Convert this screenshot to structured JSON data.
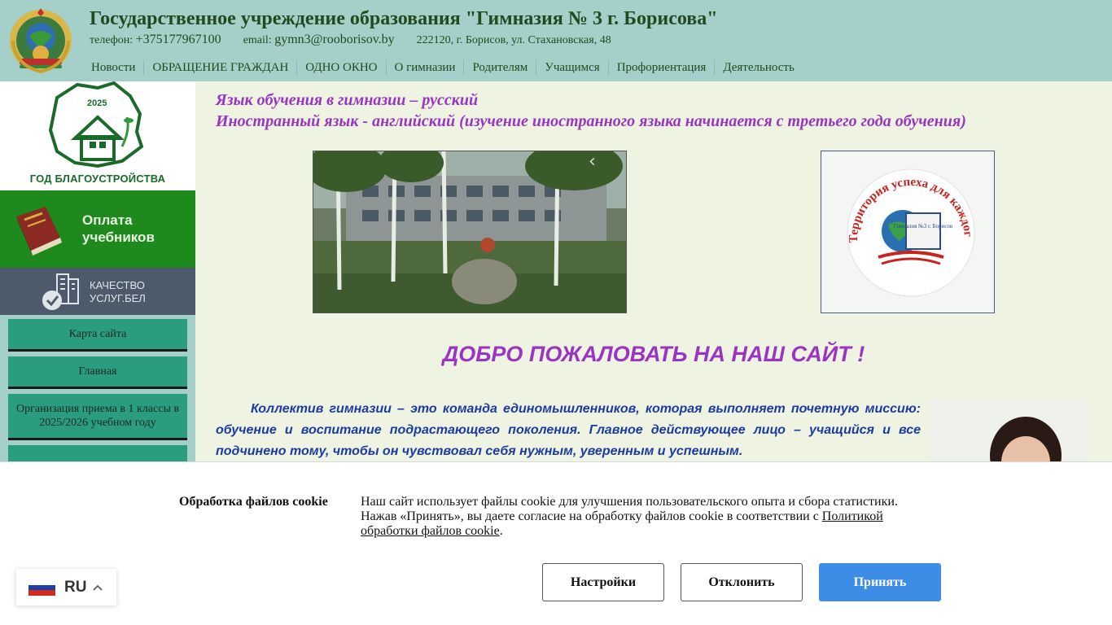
{
  "header": {
    "title": "Государственное учреждение образования \"Гимназия № 3 г. Борисова\"",
    "phone_label": "телефон:",
    "phone": "+375177967100",
    "email_label": "email:",
    "email": "gymn3@rooborisov.by",
    "address": "222120, г. Борисов, ул. Стахановская, 48",
    "nav": [
      "Новости",
      "ОБРАЩЕНИЕ ГРАЖДАН",
      "ОДНО ОКНО",
      "О гимназии",
      "Родителям",
      "Учащимся",
      "Профориентация",
      "Деятельность"
    ]
  },
  "sidebar": {
    "year_banner": {
      "year": "2025",
      "caption": "ГОД БЛАГОУСТРОЙСТВА"
    },
    "pay_banner": {
      "line1": "Оплата",
      "line2": "учебников"
    },
    "quality_banner": {
      "line1": "КАЧЕСТВО",
      "line2": "УСЛУГ.БЕЛ"
    },
    "menu": [
      "Карта сайта",
      "Главная",
      "Организация приема в 1 классы в 2025/2026 учебном году",
      ""
    ]
  },
  "main": {
    "lang_line1": "Язык обучения в гимназии – русский",
    "lang_line2": "Иностранный язык - английский (изучение иностранного языка начинается с третьего года обучения)",
    "slider_prev": "‹",
    "logo_text": "Территория успеха для каждого",
    "logo_book": "Гимназия №3 г. Борисов",
    "welcome": "ДОБРО ПОЖАЛОВАТЬ НА НАШ САЙТ !",
    "intro": "Коллектив гимназии – это команда единомышленников, которая выполняет почетную миссию: обучение и воспитание подрастающего поколения. Главное действующее лицо – учащийся и все подчинено тому, чтобы он чувствовал себя нужным, уверенным и успешным."
  },
  "cookie": {
    "title": "Обработка файлов cookie",
    "text": "Наш сайт использует файлы cookie для улучшения пользовательского опыта и сбора статистики. Нажав «Принять», вы даете согласие на обработку файлов cookie в соответствии с ",
    "link": "Политикой обработки файлов cookie",
    "text_end": ".",
    "settings": "Настройки",
    "decline": "Отклонить",
    "accept": "Принять"
  },
  "language": {
    "code": "RU"
  },
  "colors": {
    "header_bg": "#a5cfc9",
    "accent_purple": "#9a35c2",
    "intro_blue": "#1d3aa5",
    "accept_blue": "#3d8de6",
    "pay_green": "#1e8a1e",
    "menu_teal": "#2a9d7e"
  }
}
